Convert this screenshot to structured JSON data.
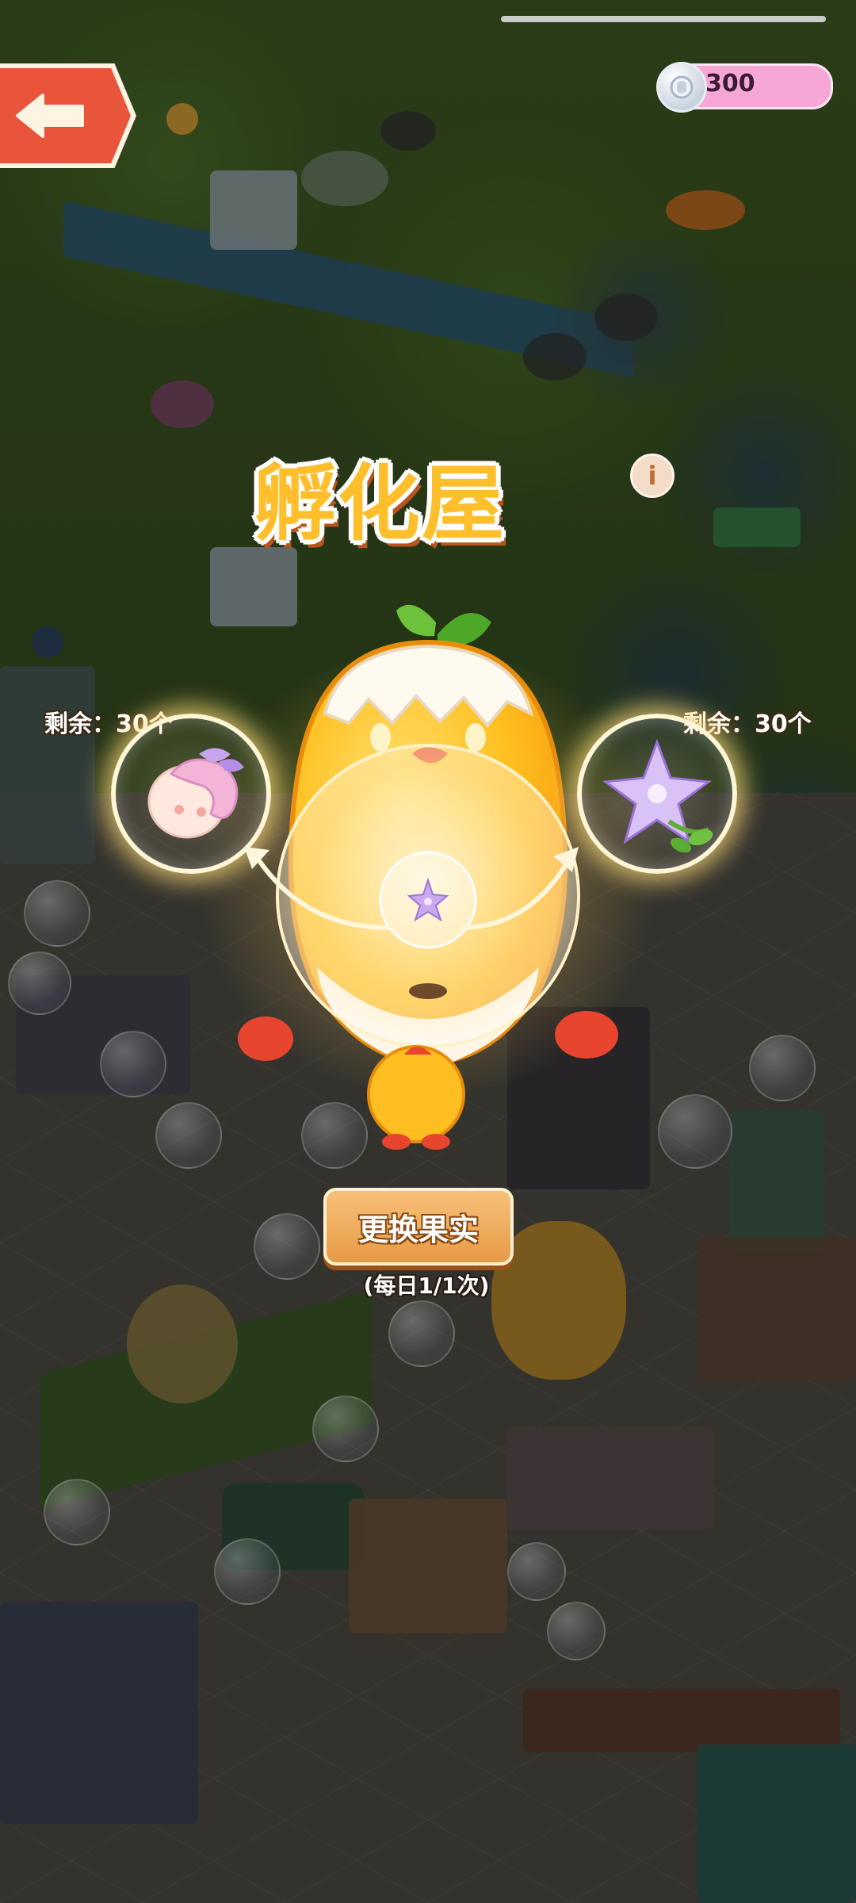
{
  "screen": "hatchery",
  "status_bar": {},
  "header": {
    "currency": {
      "icon": "silver-coin-icon",
      "value": "300"
    },
    "back_icon": "back-arrow-icon"
  },
  "hatchery": {
    "title": "孵化屋",
    "info_icon_label": "i",
    "left_fruit": {
      "remaining_label": "剩余：30个",
      "icon": "pink-flower-fairy-icon"
    },
    "right_fruit": {
      "remaining_label": "剩余：30个",
      "icon": "purple-lily-icon"
    },
    "egg_icon": "chick-egg-incubator-icon",
    "change_button_label": "更换果实",
    "daily_limit": "(每日1/1次)"
  },
  "colors": {
    "accent_orange": "#e79a45",
    "title_yellow": "#ffbf2c",
    "back_red": "#e8553b",
    "currency_pink": "#f6a7d6"
  }
}
